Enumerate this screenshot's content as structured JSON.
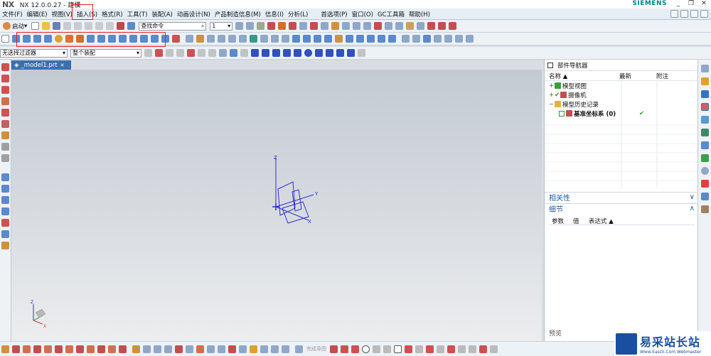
{
  "titlebar": {
    "logo": "NX",
    "title": "NX 12.0.0.27 - 建模",
    "brand": "SIEMENS",
    "min": "_",
    "restore": "❐",
    "close": "✕"
  },
  "menu": [
    "文件(F)",
    "编辑(E)",
    "视图(V)",
    "插入(S)",
    "格式(R)",
    "工具(T)",
    "装配(A)",
    "动画设计(N)",
    "产品制造信息(M)",
    "信息(I)",
    "分析(L)",
    "首选项(P)",
    "窗口(O)",
    "GC工具箱",
    "帮助(H)"
  ],
  "toolbar1": {
    "start_label": "启动",
    "search_placeholder": "查找命令",
    "combo_value": "1"
  },
  "toolbar3": {
    "filter": "无选择过滤器",
    "scope": "整个装配"
  },
  "doc_tab": {
    "label": "_model1.prt",
    "close": "✕"
  },
  "navigator": {
    "title": "部件导航器",
    "columns": [
      "名称",
      "最新",
      "附注"
    ],
    "rows": [
      {
        "sign": "+",
        "label": "模型视图"
      },
      {
        "sign": "+",
        "label": "摄像机"
      },
      {
        "sign": "−",
        "label": "模型历史记录"
      },
      {
        "sign": "",
        "label": "基准坐标系 (0)",
        "status": "✔"
      }
    ],
    "dependency": "相关性",
    "details": "细节",
    "detail_columns": [
      "参数",
      "值",
      "表达式"
    ],
    "preview": "预览"
  },
  "viewport": {
    "axis_x": "X",
    "axis_y": "Y",
    "axis_z": "Z"
  },
  "bottombar": {
    "sketch_label": "完成草图"
  },
  "watermark": {
    "cn": "易采站长站",
    "en": "Www.Easck.Com Webmaster"
  },
  "colors": {
    "accent": "#3d6fae",
    "highlight": "#e0242b",
    "csys": "#3030d0"
  }
}
